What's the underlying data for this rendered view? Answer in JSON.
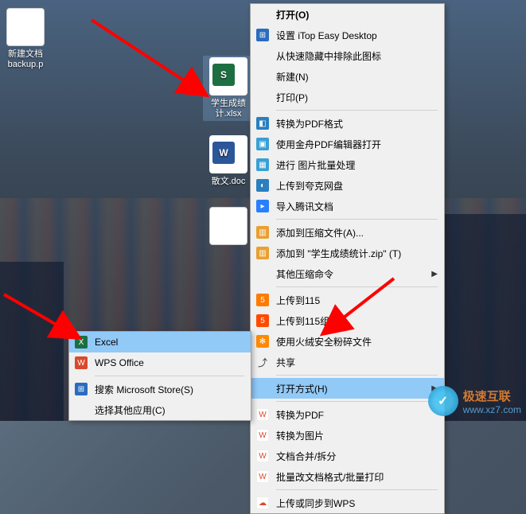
{
  "desktop": {
    "icon1_label": "新建文档\nbackup.p",
    "icon2_label": "学生成绩\n计.xlsx",
    "icon3_label": "散文.doc",
    "icon4_label": ""
  },
  "menu": {
    "open": "打开(O)",
    "itop": "设置 iTop Easy Desktop",
    "exclude": "从快速隐藏中排除此图标",
    "new": "新建(N)",
    "print": "打印(P)",
    "conv_pdf": "转换为PDF格式",
    "jz_pdf": "使用金舟PDF编辑器打开",
    "img_batch": "进行 图片批量处理",
    "kuake": "上传到夸克网盘",
    "tencent": "导入腾讯文档",
    "add_zip": "添加到压缩文件(A)...",
    "add_zip_named": "添加到 \"学生成绩统计.zip\" (T)",
    "other_zip": "其他压缩命令",
    "up_115": "上传到115",
    "up_115_group": "上传到115组织",
    "huorong": "使用火绒安全粉碎文件",
    "share": "共享",
    "open_with": "打开方式(H)",
    "w_conv_pdf": "转换为PDF",
    "w_conv_img": "转换为图片",
    "w_merge": "文档合并/拆分",
    "w_batch": "批量改文档格式/批量打印",
    "w_sync": "上传或同步到WPS"
  },
  "submenu": {
    "excel": "Excel",
    "wps": "WPS Office",
    "ms_store": "搜索 Microsoft Store(S)",
    "choose_other": "选择其他应用(C)"
  },
  "watermark": {
    "brand": "极速互联",
    "url": "www.xz7.com"
  }
}
